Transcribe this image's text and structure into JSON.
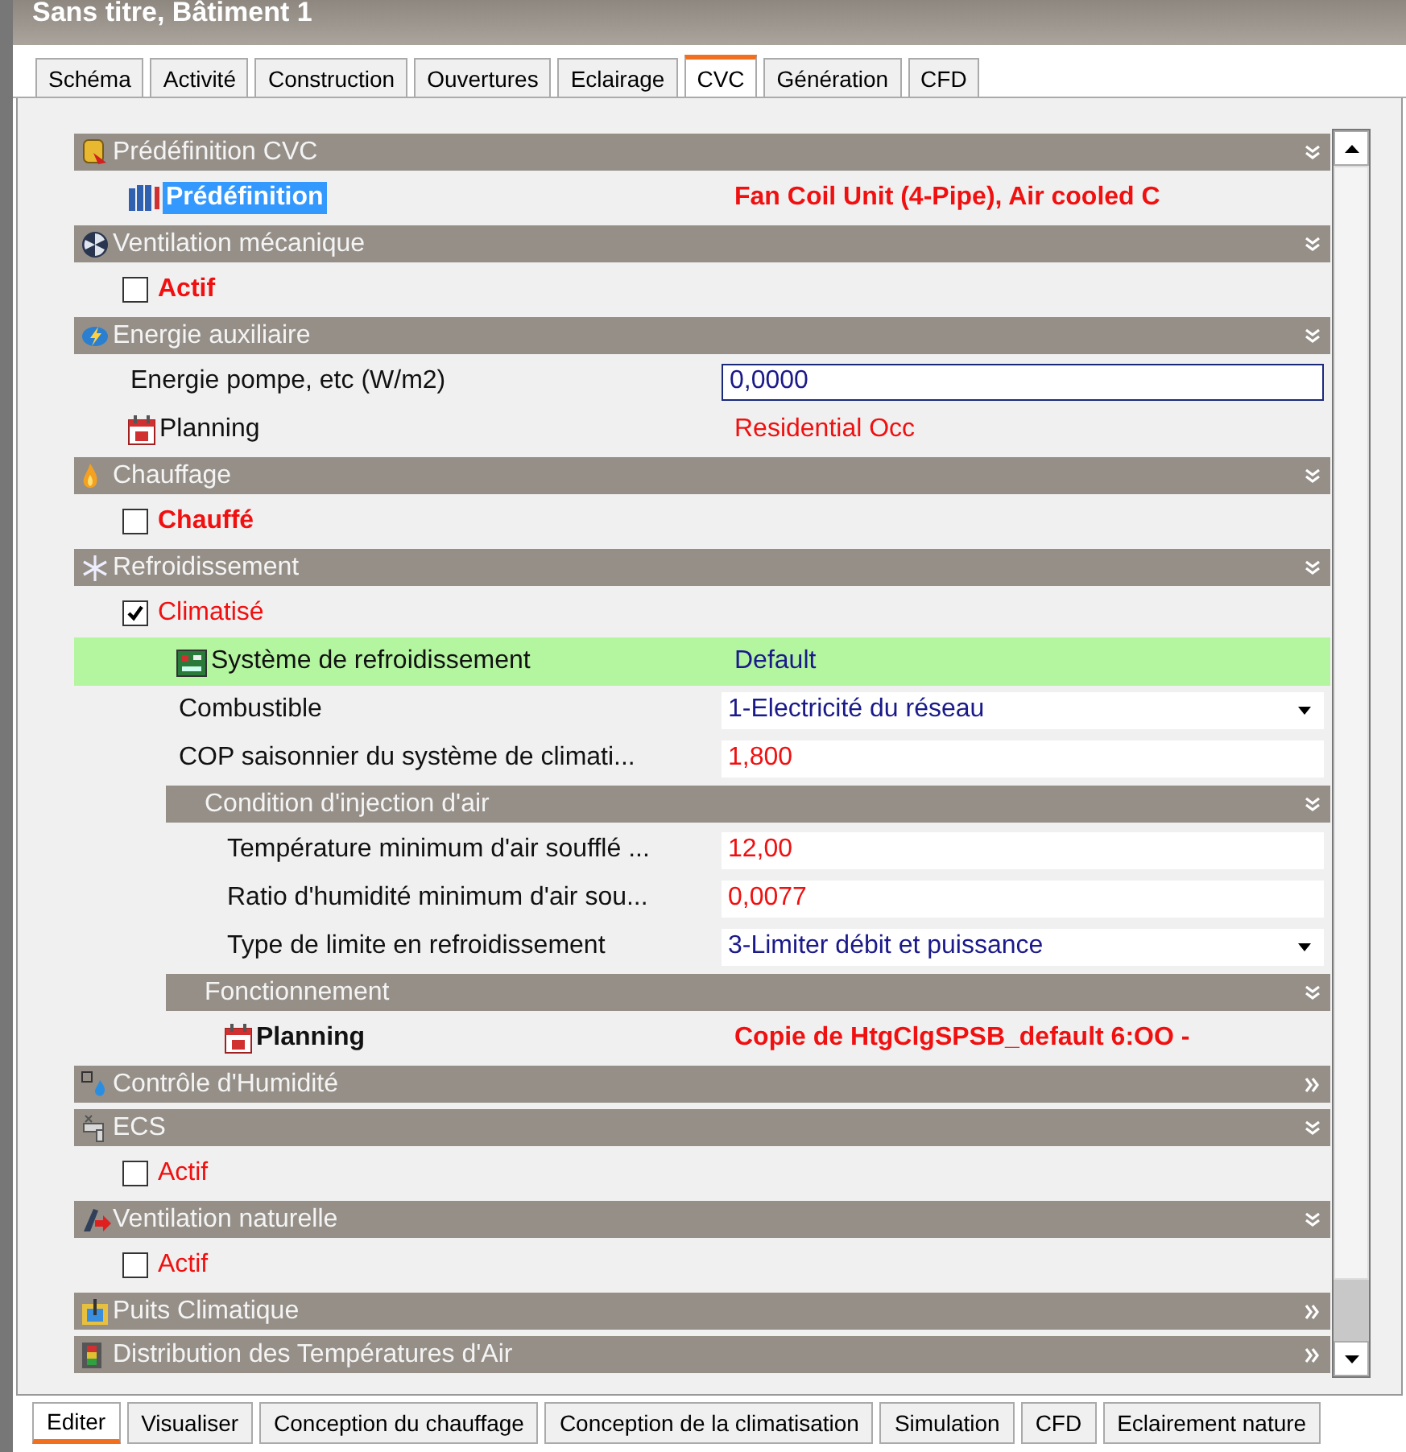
{
  "window": {
    "title": "Sans titre, Bâtiment 1"
  },
  "tabs": [
    {
      "label": "Schéma",
      "selected": false
    },
    {
      "label": "Activité",
      "selected": false
    },
    {
      "label": "Construction",
      "selected": false
    },
    {
      "label": "Ouvertures",
      "selected": false
    },
    {
      "label": "Eclairage",
      "selected": false
    },
    {
      "label": "CVC",
      "selected": true
    },
    {
      "label": "Génération",
      "selected": false
    },
    {
      "label": "CFD",
      "selected": false
    }
  ],
  "sections": [
    {
      "title": "Prédéfinition CVC",
      "expanded": true,
      "children": [
        {
          "kind": "link",
          "label": "Prédéfinition",
          "selected": true,
          "value": "Fan Coil Unit (4-Pipe), Air cooled C"
        }
      ]
    },
    {
      "title": "Ventilation mécanique",
      "expanded": true,
      "children": [
        {
          "kind": "checkbox",
          "label": "Actif",
          "checked": false,
          "bold": true
        }
      ]
    },
    {
      "title": "Energie auxiliaire",
      "expanded": true,
      "children": [
        {
          "kind": "input",
          "label": "Energie pompe, etc (W/m2)",
          "value": "0,0000",
          "focused": true
        },
        {
          "kind": "schedule",
          "label": "Planning",
          "value": "Residential Occ",
          "bold": false
        }
      ]
    },
    {
      "title": "Chauffage",
      "expanded": true,
      "children": [
        {
          "kind": "checkbox",
          "label": "Chauffé",
          "checked": false,
          "bold": true
        }
      ]
    },
    {
      "title": "Refroidissement",
      "expanded": true,
      "children": [
        {
          "kind": "checkbox",
          "label": "Climatisé",
          "checked": true,
          "bold": false,
          "children": [
            {
              "kind": "system",
              "label": "Système de refroidissement",
              "value": "Default",
              "highlighted": true
            },
            {
              "kind": "dropdown",
              "label": "Combustible",
              "value": "1-Electricité du réseau"
            },
            {
              "kind": "field",
              "label": "COP saisonnier du système de climati...",
              "value": "1,800"
            },
            {
              "kind": "section",
              "title": "Condition d'injection d'air",
              "expanded": true,
              "children": [
                {
                  "kind": "field",
                  "label": "Température minimum d'air soufflé ...",
                  "value": "12,00"
                },
                {
                  "kind": "field",
                  "label": "Ratio d'humidité minimum d'air sou...",
                  "value": "0,0077"
                },
                {
                  "kind": "dropdown",
                  "label": "Type de limite en refroidissement",
                  "value": "3-Limiter débit et puissance"
                }
              ]
            },
            {
              "kind": "section",
              "title": "Fonctionnement",
              "expanded": true,
              "children": [
                {
                  "kind": "schedule",
                  "label": "Planning",
                  "value": "Copie de HtgClgSPSB_default 6:OO -",
                  "bold": true
                }
              ]
            }
          ]
        }
      ]
    },
    {
      "title": "Contrôle d'Humidité",
      "expanded": false
    },
    {
      "title": "ECS",
      "expanded": true,
      "children": [
        {
          "kind": "checkbox",
          "label": "Actif",
          "checked": false,
          "bold": false
        }
      ]
    },
    {
      "title": "Ventilation naturelle",
      "expanded": true,
      "children": [
        {
          "kind": "checkbox",
          "label": "Actif",
          "checked": false,
          "bold": false
        }
      ]
    },
    {
      "title": "Puits Climatique",
      "expanded": false
    },
    {
      "title": "Distribution des Températures d'Air",
      "expanded": false
    }
  ],
  "bottom_tabs": [
    {
      "label": "Editer",
      "selected": true
    },
    {
      "label": "Visualiser",
      "selected": false
    },
    {
      "label": "Conception du chauffage",
      "selected": false
    },
    {
      "label": "Conception de la climatisation",
      "selected": false
    },
    {
      "label": "Simulation",
      "selected": false
    },
    {
      "label": "CFD",
      "selected": false
    },
    {
      "label": "Eclairement nature",
      "selected": false
    }
  ]
}
